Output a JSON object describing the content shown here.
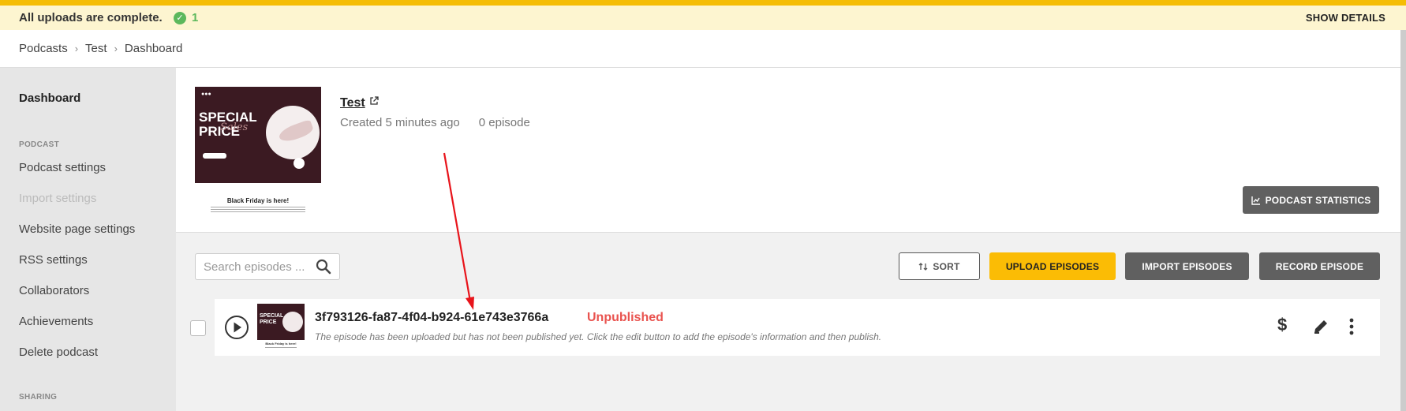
{
  "notice": {
    "message": "All uploads are complete.",
    "count": "1",
    "details_label": "SHOW DETAILS",
    "bar_color": "#f5bd06",
    "background": "#fdf5d0"
  },
  "breadcrumb": [
    "Podcasts",
    "Test",
    "Dashboard"
  ],
  "sidebar": {
    "dashboard_label": "Dashboard",
    "podcast_section": "PODCAST",
    "items": [
      {
        "label": "Podcast settings",
        "enabled": true
      },
      {
        "label": "Import settings",
        "enabled": false
      },
      {
        "label": "Website page settings",
        "enabled": true
      },
      {
        "label": "RSS settings",
        "enabled": true
      },
      {
        "label": "Collaborators",
        "enabled": true
      },
      {
        "label": "Achievements",
        "enabled": true
      },
      {
        "label": "Delete podcast",
        "enabled": true
      }
    ],
    "sharing_section": "SHARING"
  },
  "podcast": {
    "title": "Test",
    "created": "Created 5 minutes ago",
    "episode_count": "0 episode",
    "stats_label": "PODCAST STATISTICS",
    "cover": {
      "headline": "SPECIAL\nPRICE",
      "script_text": "Sales",
      "caption": "Black Friday is here!"
    }
  },
  "toolbar": {
    "search_placeholder": "Search episodes ...",
    "sort_label": "SORT",
    "upload_label": "UPLOAD EPISODES",
    "import_label": "IMPORT EPISODES",
    "record_label": "RECORD EPISODE",
    "accent_color": "#fbbc05"
  },
  "episodes": [
    {
      "title": "3f793126-fa87-4f04-b924-61e743e3766a",
      "status": "Unpublished",
      "status_color": "#e9534f",
      "description": "The episode has been uploaded but has not been published yet. Click the edit button to add the episode's information and then publish.",
      "thumb_headline": "SPECIAL\nPRICE",
      "thumb_caption": "Black Friday is here!",
      "actions": [
        "dollar-icon",
        "edit-icon",
        "more-vertical-icon"
      ]
    }
  ],
  "annotation": {
    "color": "#e8141b"
  }
}
